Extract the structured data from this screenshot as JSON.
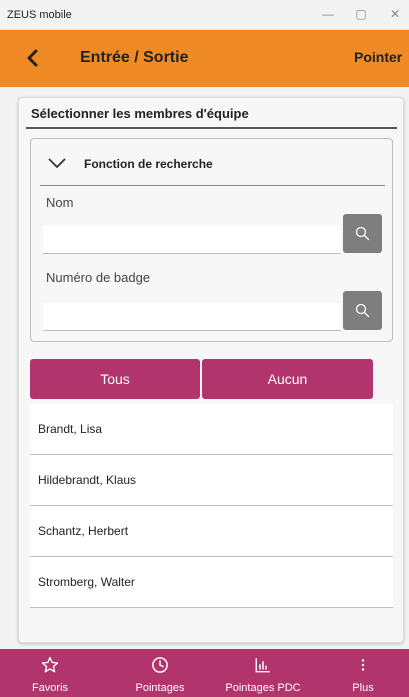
{
  "window": {
    "app_name": "ZEUS mobile",
    "minimize": "—",
    "maximize": "▢",
    "close": "✕"
  },
  "header": {
    "title": "Entrée / Sortie",
    "action_label": "Pointer",
    "color": "#f08a24"
  },
  "card": {
    "title": "Sélectionner les membres d'équipe"
  },
  "search": {
    "title": "Fonction de recherche",
    "name_label": "Nom",
    "name_value": "",
    "badge_label": "Numéro de badge",
    "badge_value": ""
  },
  "buttons": {
    "all_label": "Tous",
    "none_label": "Aucun",
    "accent": "#b1356c"
  },
  "members": [
    "Brandt, Lisa",
    "Hildebrandt, Klaus",
    "Schantz, Herbert",
    "Stromberg, Walter"
  ],
  "nav": {
    "favoris": "Favoris",
    "pointages": "Pointages",
    "pointages_pdc": "Pointages PDC",
    "plus": "Plus"
  },
  "icons": [
    "back-arrow-icon",
    "chevron-down-icon",
    "search-icon",
    "star-icon",
    "clock-icon",
    "chart-icon",
    "more-vertical-icon"
  ]
}
